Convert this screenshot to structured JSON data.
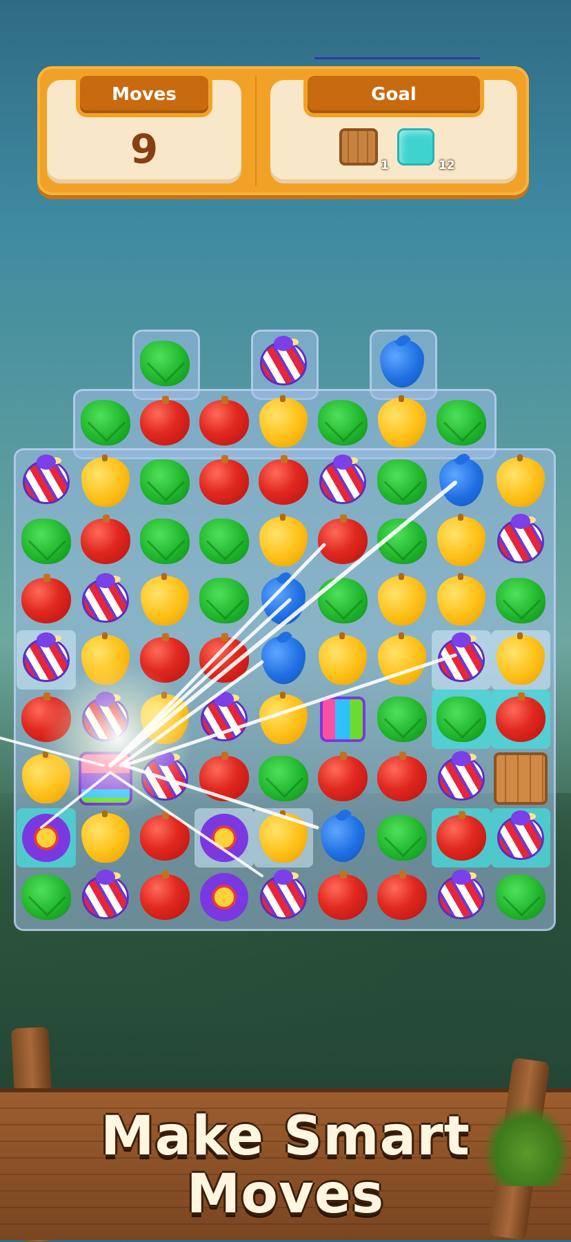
{
  "hud": {
    "moves_label": "Moves",
    "moves_value": "9",
    "goal_label": "Goal",
    "goals": [
      {
        "item": "wooden-crate",
        "count": "1"
      },
      {
        "item": "ice-tile",
        "count": "12"
      }
    ]
  },
  "board": {
    "columns": 9,
    "rows": 10,
    "cells": [
      {
        "r": 0,
        "c": 2,
        "piece": "leaf"
      },
      {
        "r": 0,
        "c": 4,
        "piece": "candy"
      },
      {
        "r": 0,
        "c": 6,
        "piece": "drop"
      },
      {
        "r": 1,
        "c": 1,
        "piece": "leaf"
      },
      {
        "r": 1,
        "c": 2,
        "piece": "apple"
      },
      {
        "r": 1,
        "c": 3,
        "piece": "apple"
      },
      {
        "r": 1,
        "c": 4,
        "piece": "pear"
      },
      {
        "r": 1,
        "c": 5,
        "piece": "leaf"
      },
      {
        "r": 1,
        "c": 6,
        "piece": "pear"
      },
      {
        "r": 1,
        "c": 7,
        "piece": "leaf"
      },
      {
        "r": 2,
        "c": 0,
        "piece": "candy"
      },
      {
        "r": 2,
        "c": 1,
        "piece": "pear"
      },
      {
        "r": 2,
        "c": 2,
        "piece": "leaf"
      },
      {
        "r": 2,
        "c": 3,
        "piece": "apple"
      },
      {
        "r": 2,
        "c": 4,
        "piece": "apple"
      },
      {
        "r": 2,
        "c": 5,
        "piece": "candy"
      },
      {
        "r": 2,
        "c": 6,
        "piece": "leaf"
      },
      {
        "r": 2,
        "c": 7,
        "piece": "drop"
      },
      {
        "r": 2,
        "c": 8,
        "piece": "pear"
      },
      {
        "r": 3,
        "c": 0,
        "piece": "leaf"
      },
      {
        "r": 3,
        "c": 1,
        "piece": "apple"
      },
      {
        "r": 3,
        "c": 2,
        "piece": "leaf"
      },
      {
        "r": 3,
        "c": 3,
        "piece": "leaf"
      },
      {
        "r": 3,
        "c": 4,
        "piece": "pear"
      },
      {
        "r": 3,
        "c": 5,
        "piece": "apple"
      },
      {
        "r": 3,
        "c": 6,
        "piece": "leaf"
      },
      {
        "r": 3,
        "c": 7,
        "piece": "pear"
      },
      {
        "r": 3,
        "c": 8,
        "piece": "candy"
      },
      {
        "r": 4,
        "c": 0,
        "piece": "apple"
      },
      {
        "r": 4,
        "c": 1,
        "piece": "candy"
      },
      {
        "r": 4,
        "c": 2,
        "piece": "pear"
      },
      {
        "r": 4,
        "c": 3,
        "piece": "leaf"
      },
      {
        "r": 4,
        "c": 4,
        "piece": "drop"
      },
      {
        "r": 4,
        "c": 5,
        "piece": "leaf"
      },
      {
        "r": 4,
        "c": 6,
        "piece": "pear"
      },
      {
        "r": 4,
        "c": 7,
        "piece": "pear"
      },
      {
        "r": 4,
        "c": 8,
        "piece": "leaf"
      },
      {
        "r": 5,
        "c": 0,
        "piece": "candy",
        "tile": "frost"
      },
      {
        "r": 5,
        "c": 1,
        "piece": "pear"
      },
      {
        "r": 5,
        "c": 2,
        "piece": "apple"
      },
      {
        "r": 5,
        "c": 3,
        "piece": "apple"
      },
      {
        "r": 5,
        "c": 4,
        "piece": "drop"
      },
      {
        "r": 5,
        "c": 5,
        "piece": "pear"
      },
      {
        "r": 5,
        "c": 6,
        "piece": "pear"
      },
      {
        "r": 5,
        "c": 7,
        "piece": "candy",
        "tile": "frost"
      },
      {
        "r": 5,
        "c": 8,
        "piece": "pear",
        "tile": "frost"
      },
      {
        "r": 6,
        "c": 0,
        "piece": "apple"
      },
      {
        "r": 6,
        "c": 1,
        "piece": "candy"
      },
      {
        "r": 6,
        "c": 2,
        "piece": "pear"
      },
      {
        "r": 6,
        "c": 3,
        "piece": "candy"
      },
      {
        "r": 6,
        "c": 4,
        "piece": "pear"
      },
      {
        "r": 6,
        "c": 5,
        "piece": "cube"
      },
      {
        "r": 6,
        "c": 6,
        "piece": "leaf"
      },
      {
        "r": 6,
        "c": 7,
        "piece": "leaf",
        "tile": "ice"
      },
      {
        "r": 6,
        "c": 8,
        "piece": "apple",
        "tile": "ice"
      },
      {
        "r": 7,
        "c": 0,
        "piece": "pear"
      },
      {
        "r": 7,
        "c": 1,
        "piece": "present"
      },
      {
        "r": 7,
        "c": 2,
        "piece": "candy"
      },
      {
        "r": 7,
        "c": 3,
        "piece": "apple"
      },
      {
        "r": 7,
        "c": 4,
        "piece": "leaf"
      },
      {
        "r": 7,
        "c": 5,
        "piece": "apple"
      },
      {
        "r": 7,
        "c": 6,
        "piece": "apple"
      },
      {
        "r": 7,
        "c": 7,
        "piece": "candy"
      },
      {
        "r": 7,
        "c": 8,
        "piece": "crate"
      },
      {
        "r": 8,
        "c": 0,
        "piece": "flower",
        "tile": "ice"
      },
      {
        "r": 8,
        "c": 1,
        "piece": "pear"
      },
      {
        "r": 8,
        "c": 2,
        "piece": "apple"
      },
      {
        "r": 8,
        "c": 3,
        "piece": "flower",
        "tile": "frost"
      },
      {
        "r": 8,
        "c": 4,
        "piece": "pear",
        "tile": "frost"
      },
      {
        "r": 8,
        "c": 5,
        "piece": "drop"
      },
      {
        "r": 8,
        "c": 6,
        "piece": "leaf"
      },
      {
        "r": 8,
        "c": 7,
        "piece": "apple",
        "tile": "ice"
      },
      {
        "r": 8,
        "c": 8,
        "piece": "candy",
        "tile": "ice"
      },
      {
        "r": 9,
        "c": 0,
        "piece": "leaf"
      },
      {
        "r": 9,
        "c": 1,
        "piece": "candy"
      },
      {
        "r": 9,
        "c": 2,
        "piece": "apple"
      },
      {
        "r": 9,
        "c": 3,
        "piece": "flower"
      },
      {
        "r": 9,
        "c": 4,
        "piece": "candy"
      },
      {
        "r": 9,
        "c": 5,
        "piece": "apple"
      },
      {
        "r": 9,
        "c": 6,
        "piece": "apple"
      },
      {
        "r": 9,
        "c": 7,
        "piece": "candy"
      },
      {
        "r": 9,
        "c": 8,
        "piece": "leaf"
      }
    ]
  },
  "banner": {
    "line1": "Make Smart",
    "line2": "Moves"
  },
  "colors": {
    "hud_frame": "#f2a127",
    "hud_tab": "#c86a10",
    "moves_text": "#8a3e14",
    "board_tile": "#a0bee6",
    "ice_tile": "#46dcdc"
  }
}
